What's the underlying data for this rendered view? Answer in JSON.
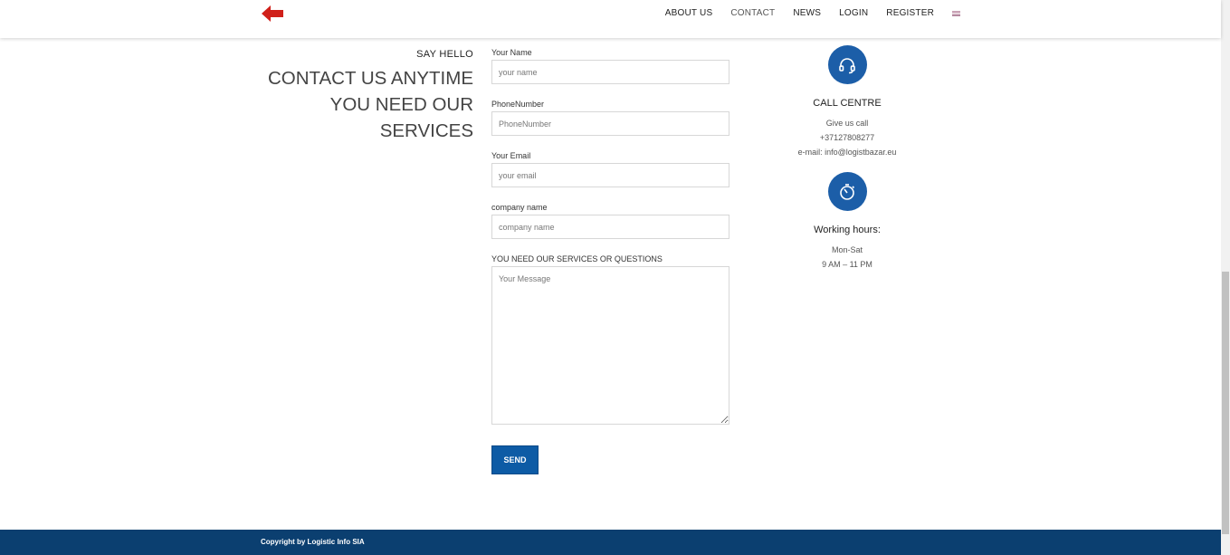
{
  "header": {
    "nav": [
      "ABOUT US",
      "CONTACT",
      "NEWS",
      "LOGIN",
      "REGISTER"
    ],
    "active": "CONTACT",
    "logo_icon": "red-left-arrow",
    "language_icon": "uk-flag-icon"
  },
  "intro": {
    "eyebrow": "SAY HELLO",
    "headline_lines": [
      "CONTACT US ANYTIME",
      "YOU NEED OUR",
      "SERVICES"
    ]
  },
  "form": {
    "name_label": "Your Name",
    "name_placeholder": "your name",
    "phone_label": "PhoneNumber",
    "phone_placeholder": "PhoneNumber",
    "email_label": "Your Email",
    "email_placeholder": "your email",
    "company_label": "company name",
    "company_placeholder": "company name",
    "message_label": "YOU NEED OUR SERVICES OR QUESTIONS",
    "message_placeholder": "Your Message",
    "send_label": "SEND"
  },
  "contact": {
    "call_title": "CALL CENTRE",
    "call_lines": [
      "Give us call",
      "+37127808277",
      "e-mail: info@logistbazar.eu"
    ],
    "hours_title": "Working hours:",
    "hours_lines": [
      "Mon-Sat",
      "9 AM – 11 PM"
    ]
  },
  "footer": {
    "copyright": "Copyright by Logistic Info SIA"
  },
  "colors": {
    "accent": "#1c5ea8",
    "footer": "#0b3f70",
    "logo": "#d0201a"
  }
}
